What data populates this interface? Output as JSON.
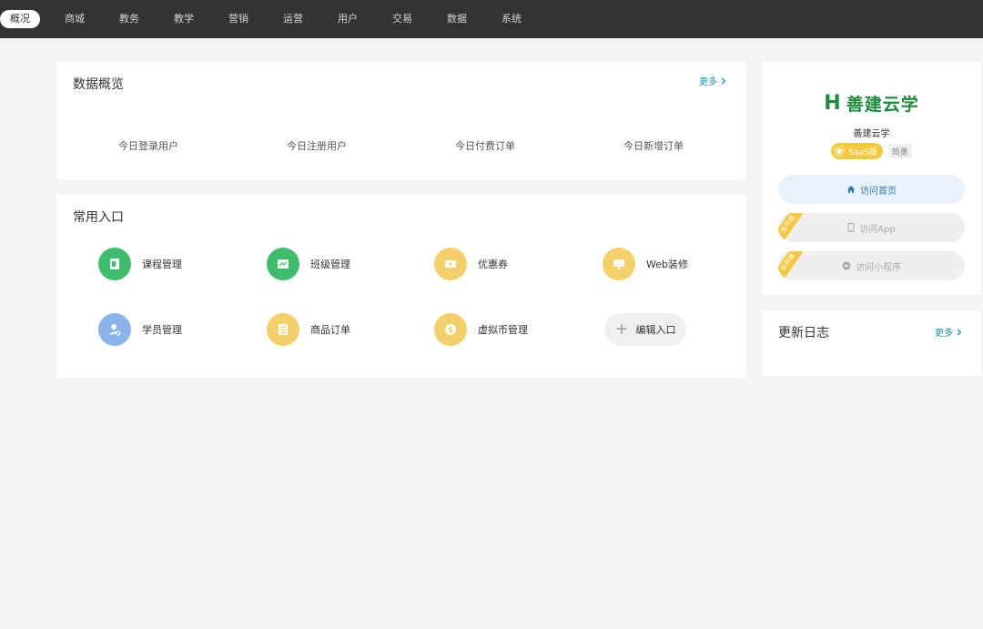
{
  "nav": {
    "items": [
      "概况",
      "商城",
      "教务",
      "教学",
      "营销",
      "运营",
      "用户",
      "交易",
      "数据",
      "系统"
    ],
    "active_index": 0
  },
  "overview": {
    "title": "数据概览",
    "more": "更多",
    "stats": [
      "今日登录用户",
      "今日注册用户",
      "今日付费订单",
      "今日新增订单"
    ]
  },
  "shortcuts": {
    "title": "常用入口",
    "items": [
      {
        "label": "课程管理",
        "icon": "course-icon",
        "color": "#3ebc6a"
      },
      {
        "label": "班级管理",
        "icon": "class-icon",
        "color": "#3ebc6a"
      },
      {
        "label": "优惠券",
        "icon": "coupon-icon",
        "color": "#f5cf6a"
      },
      {
        "label": "Web装修",
        "icon": "monitor-icon",
        "color": "#f5cf6a"
      },
      {
        "label": "学员管理",
        "icon": "student-icon",
        "color": "#8cb3ea"
      },
      {
        "label": "商品订单",
        "icon": "order-icon",
        "color": "#f5cf6a"
      },
      {
        "label": "虚拟币管理",
        "icon": "coin-icon",
        "color": "#f5cf6a"
      }
    ],
    "edit_label": "编辑入口"
  },
  "brand": {
    "logo_mark": "H",
    "logo_text": "善建云学",
    "name": "善建云学",
    "badge_saas": "SaaS版",
    "badge_intro": "简墨",
    "visit_home": "访问首页",
    "visit_app": "访问App",
    "visit_mini": "访问小程序",
    "ribbon": "未开通",
    "brand_color": "#1f8a3c"
  },
  "updates": {
    "title": "更新日志",
    "more": "更多"
  }
}
